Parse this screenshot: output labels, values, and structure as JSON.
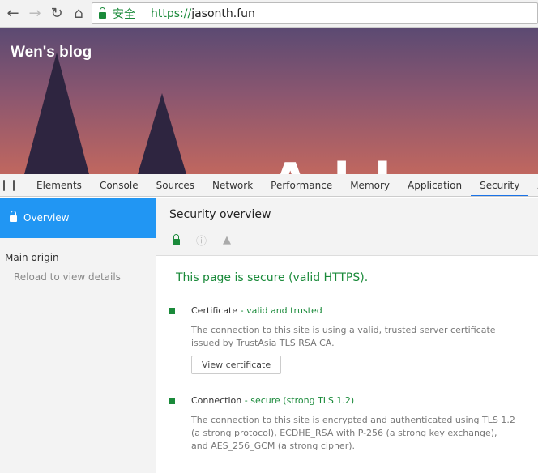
{
  "browser": {
    "secure_label": "安全",
    "url_scheme": "https://",
    "url_host": "jasonth.fun"
  },
  "page": {
    "blog_title": "Wen's blog",
    "hero_text": "All"
  },
  "devtools": {
    "tabs": [
      "Elements",
      "Console",
      "Sources",
      "Network",
      "Performance",
      "Memory",
      "Application",
      "Security",
      "Au"
    ],
    "active_tab": "Security"
  },
  "sidebar": {
    "overview": "Overview",
    "main_origin": "Main origin",
    "reload": "Reload to view details"
  },
  "main": {
    "title": "Security overview",
    "summary": "This page is secure (valid HTTPS).",
    "certificate": {
      "label": "Certificate",
      "status": "- valid and trusted",
      "desc": "The connection to this site is using a valid, trusted server certificate issued by TrustAsia TLS RSA CA.",
      "button": "View certificate"
    },
    "connection": {
      "label": "Connection",
      "status": "- secure (strong TLS 1.2)",
      "desc": "The connection to this site is encrypted and authenticated using TLS 1.2 (a strong protocol), ECDHE_RSA with P-256 (a strong key exchange), and AES_256_GCM (a strong cipher)."
    }
  },
  "colors": {
    "secure": "#1a8a3a",
    "accent": "#2196f3"
  }
}
